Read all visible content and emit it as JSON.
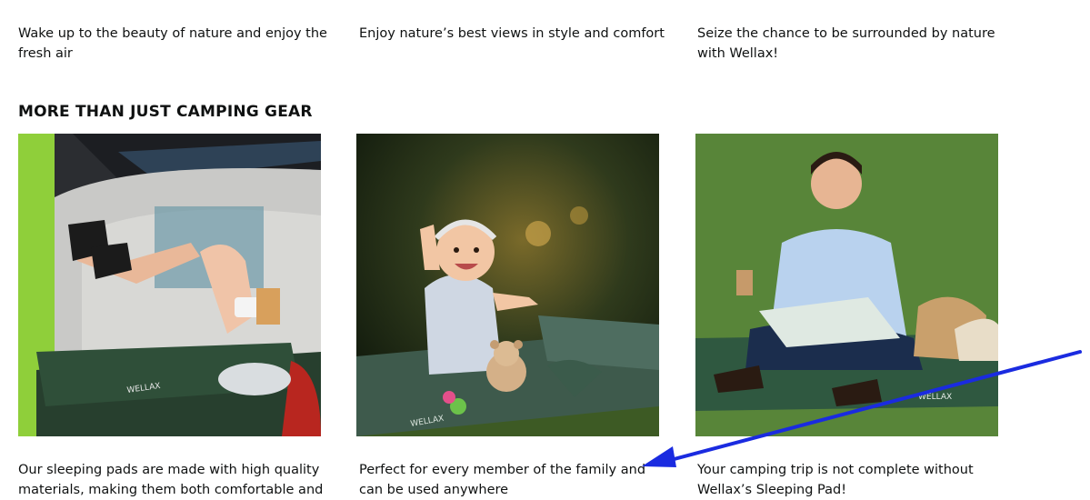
{
  "top_captions": [
    "Wake up to the beauty of nature and enjoy the fresh air",
    "Enjoy nature’s best views in style and comfort",
    "Seize the chance to be surrounded by nature with Wellax!"
  ],
  "section": {
    "title": "MORE THAN JUST CAMPING GEAR"
  },
  "photos": [
    {
      "icon": "car-trunk-sleeping-pad-photo",
      "brand_mark": "WELLAX"
    },
    {
      "icon": "baby-on-sleeping-pad-photo",
      "brand_mark": "WELLAX"
    },
    {
      "icon": "man-on-sleeping-pad-photo",
      "brand_mark": "WELLAX"
    }
  ],
  "bottom_captions": [
    "Our sleeping pads are made with high quality materials, making them both comfortable and",
    "Perfect for every member of the family and can be used anywhere",
    "Your camping trip is not complete without Wellax’s Sleeping Pad!"
  ],
  "annotation": {
    "color": "#1a2be0"
  }
}
